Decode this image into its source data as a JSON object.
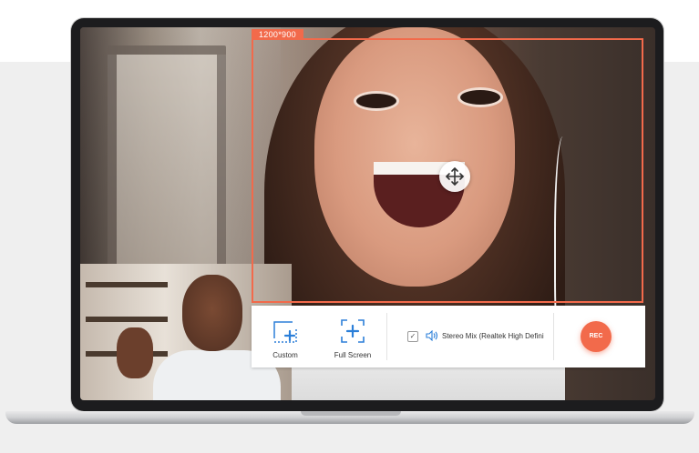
{
  "capture": {
    "size_tag": "1200*900",
    "accent_color": "#f26a4b"
  },
  "toolbar": {
    "custom_label": "Custom",
    "fullscreen_label": "Full Screen",
    "audio_checked_glyph": "✓",
    "audio_source_label": "Stereo Mix (Realtek High Defini",
    "rec_label": "REC"
  },
  "icons": {
    "move": "move-arrows-icon",
    "custom": "custom-region-icon",
    "fullscreen": "fullscreen-icon",
    "speaker": "speaker-icon"
  }
}
